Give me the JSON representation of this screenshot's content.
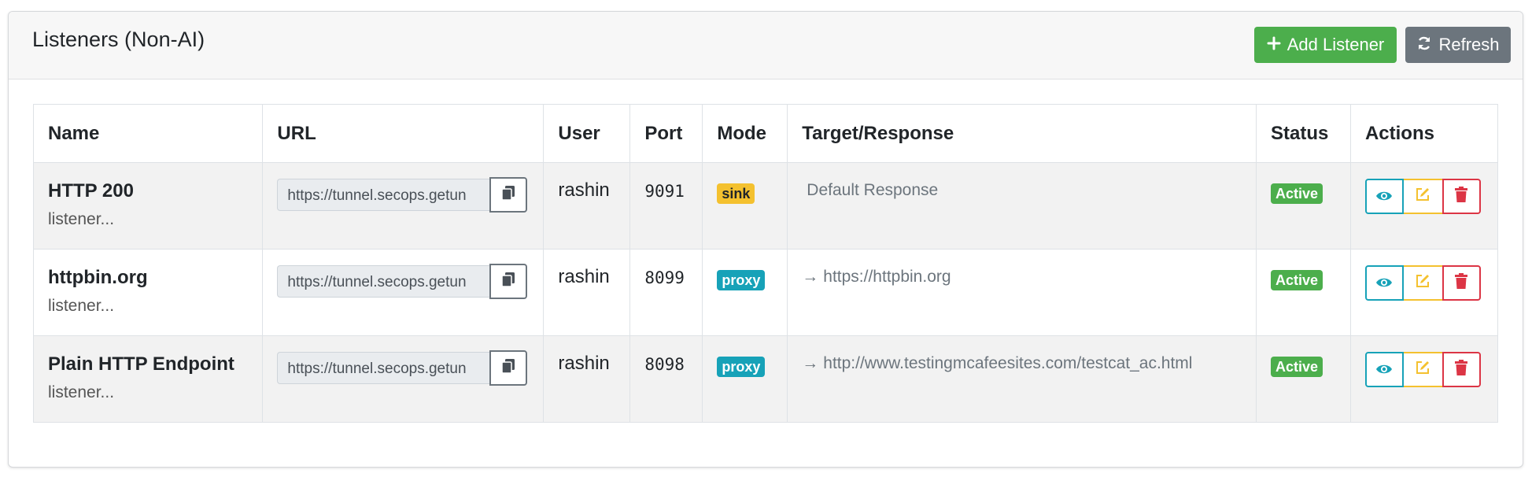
{
  "header": {
    "title": "Listeners (Non-AI)",
    "add_label": "Add Listener",
    "refresh_label": "Refresh",
    "add_icon": "plus-icon",
    "refresh_icon": "refresh-icon"
  },
  "colors": {
    "success": "#4cae4c",
    "secondary": "#6c757d",
    "info": "#17a2b8",
    "warning": "#f4c12f",
    "danger": "#dc3545"
  },
  "table": {
    "columns": [
      "Name",
      "URL",
      "User",
      "Port",
      "Mode",
      "Target/Response",
      "Status",
      "Actions"
    ],
    "rows": [
      {
        "name": "HTTP 200",
        "subtitle": "listener...",
        "url": "https://tunnel.secops.getun",
        "user": "rashin",
        "port": "9091",
        "mode": "sink",
        "target": "Default Response",
        "target_arrow": "",
        "status": "Active"
      },
      {
        "name": "httpbin.org",
        "subtitle": "listener...",
        "url": "https://tunnel.secops.getun",
        "user": "rashin",
        "port": "8099",
        "mode": "proxy",
        "target": "https://httpbin.org",
        "target_arrow": "→",
        "status": "Active"
      },
      {
        "name": "Plain HTTP Endpoint",
        "subtitle": "listener...",
        "url": "https://tunnel.secops.getun",
        "user": "rashin",
        "port": "8098",
        "mode": "proxy",
        "target": "http://www.testingmcafeesites.com/testcat_ac.html",
        "target_arrow": "→",
        "status": "Active"
      }
    ]
  }
}
